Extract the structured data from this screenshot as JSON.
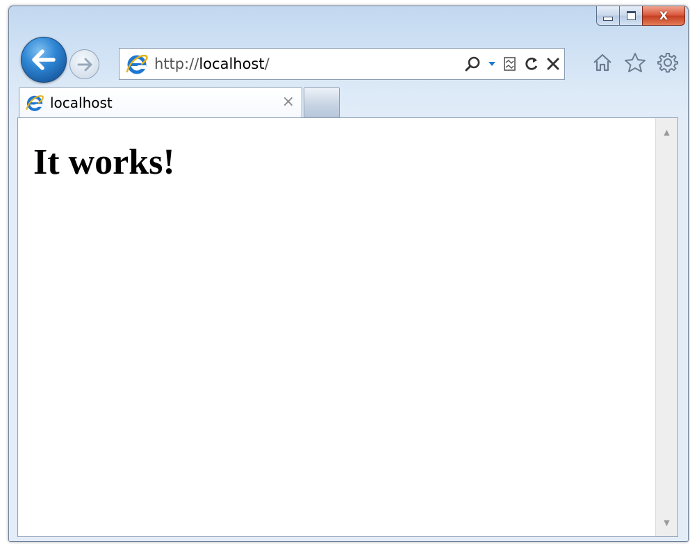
{
  "window": {
    "minimize_label": "",
    "maximize_label": "",
    "close_label": "X"
  },
  "address": {
    "scheme": "http://",
    "host": "localhost",
    "path": "/"
  },
  "tabs": [
    {
      "label": "localhost",
      "close": "×"
    }
  ],
  "page": {
    "heading": "It works!"
  },
  "icons": {
    "back": "back-arrow-icon",
    "forward": "forward-arrow-icon",
    "search": "search-icon",
    "dropdown": "chevron-down-icon",
    "compat": "compatibility-view-icon",
    "refresh": "refresh-icon",
    "stop": "stop-icon",
    "home": "home-icon",
    "favorites": "star-icon",
    "tools": "gear-icon",
    "page_icon": "internet-explorer-icon"
  },
  "colors": {
    "accent": "#2f86d4",
    "close": "#c53d20",
    "frame": "#c2d8f0"
  }
}
